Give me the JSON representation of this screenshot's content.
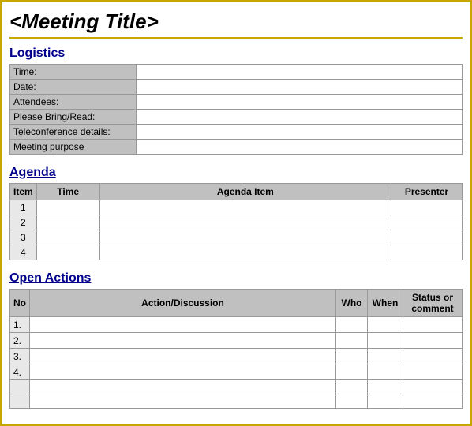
{
  "title": "<Meeting Title>",
  "logistics": {
    "section_label": "Logistics",
    "rows": [
      {
        "label": "Time:",
        "value": ""
      },
      {
        "label": "Date:",
        "value": ""
      },
      {
        "label": "Attendees:",
        "value": ""
      },
      {
        "label": "Please Bring/Read:",
        "value": ""
      },
      {
        "label": "Teleconference details:",
        "value": ""
      },
      {
        "label": "Meeting purpose",
        "value": ""
      }
    ]
  },
  "agenda": {
    "section_label": "Agenda",
    "columns": [
      "Item",
      "Time",
      "Agenda Item",
      "Presenter"
    ],
    "rows": [
      {
        "item": "1",
        "time": "",
        "agenda_item": "",
        "presenter": ""
      },
      {
        "item": "2",
        "time": "",
        "agenda_item": "",
        "presenter": ""
      },
      {
        "item": "3",
        "time": "",
        "agenda_item": "",
        "presenter": ""
      },
      {
        "item": "4",
        "time": "",
        "agenda_item": "",
        "presenter": ""
      }
    ]
  },
  "open_actions": {
    "section_label": "Open Actions",
    "columns": {
      "no": "No",
      "action": "Action/Discussion",
      "who": "Who",
      "when": "When",
      "status": "Status or comment"
    },
    "rows": [
      {
        "no": "1.",
        "action": "",
        "who": "",
        "when": "",
        "status": ""
      },
      {
        "no": "2.",
        "action": "",
        "who": "",
        "when": "",
        "status": ""
      },
      {
        "no": "3.",
        "action": "",
        "who": "",
        "when": "",
        "status": ""
      },
      {
        "no": "4.",
        "action": "",
        "who": "",
        "when": "",
        "status": ""
      },
      {
        "no": "",
        "action": "",
        "who": "",
        "when": "",
        "status": ""
      },
      {
        "no": "",
        "action": "",
        "who": "",
        "when": "",
        "status": ""
      }
    ]
  }
}
